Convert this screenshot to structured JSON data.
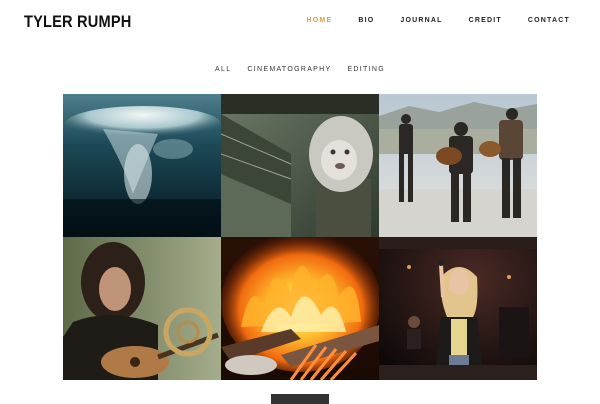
{
  "site": {
    "logo": "TYLER RUMPH"
  },
  "nav": {
    "items": [
      {
        "label": "HOME",
        "active": true
      },
      {
        "label": "BIO",
        "active": false
      },
      {
        "label": "JOURNAL",
        "active": false
      },
      {
        "label": "CREDIT",
        "active": false
      },
      {
        "label": "CONTACT",
        "active": false
      }
    ],
    "accent_color": "#d4a24a"
  },
  "filters": {
    "items": [
      {
        "label": "ALL"
      },
      {
        "label": "CINEMATOGRAPHY"
      },
      {
        "label": "EDITING"
      }
    ]
  },
  "portfolio": {
    "tiles": [
      {
        "subject": "underwater-splash"
      },
      {
        "subject": "lion-mask-on-bridge"
      },
      {
        "subject": "band-playing-on-rooftop"
      },
      {
        "subject": "guitarist-with-french-horn"
      },
      {
        "subject": "campfire"
      },
      {
        "subject": "singer-on-stage"
      }
    ]
  },
  "load_more_color": "#333333"
}
